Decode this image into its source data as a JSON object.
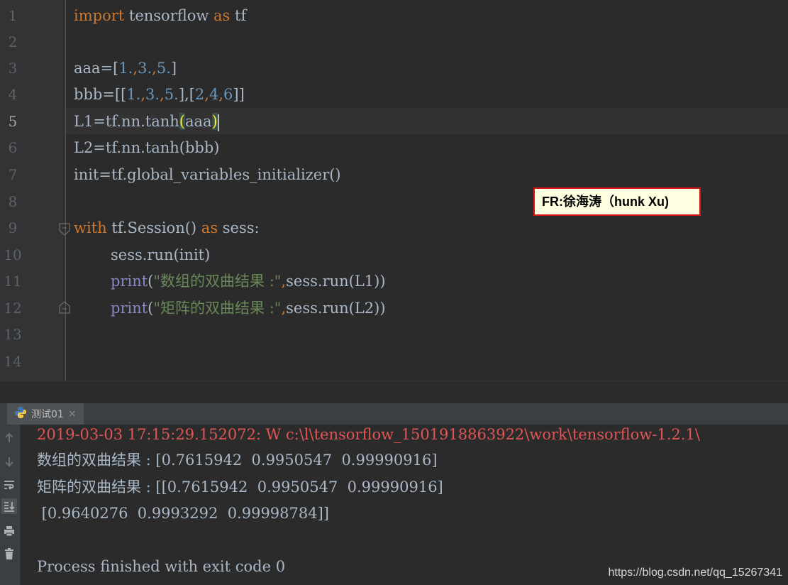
{
  "editor": {
    "line_numbers": [
      "1",
      "2",
      "3",
      "4",
      "5",
      "6",
      "7",
      "8",
      "9",
      "10",
      "11",
      "12",
      "13",
      "14"
    ],
    "line1": {
      "kw_import": "import",
      "module": " tensorflow ",
      "kw_as": "as",
      "alias": " tf"
    },
    "line3": {
      "lhs": "aaa=[",
      "n1": "1.",
      "c1": ",",
      "n2": "3.",
      "c2": ",",
      "n3": "5.",
      "end": "]"
    },
    "line4": {
      "lhs": "bbb=[[",
      "n1": "1.",
      "c1": ",",
      "n2": "3.",
      "c2": ",",
      "n3": "5.",
      "mid": "],[",
      "n4": "2",
      "c3": ",",
      "n5": "4",
      "c4": ",",
      "n6": "6",
      "end": "]]"
    },
    "line5": {
      "lhs": "L1=tf.nn.tanh",
      "open": "(",
      "arg": "aaa",
      "close": ")"
    },
    "line6": {
      "text": "L2=tf.nn.tanh(bbb)"
    },
    "line7": {
      "text": "init=tf.global_variables_initializer()"
    },
    "line9": {
      "kw_with": "with",
      "mid": " tf.Session() ",
      "kw_as": "as",
      "end": " sess:"
    },
    "line10": {
      "text": "sess.run(init)"
    },
    "line11": {
      "fn": "print",
      "open": "(",
      "str": "\"数组的双曲结果 :\"",
      "kw_comma": ",",
      "rest": "sess.run(L1))"
    },
    "line12": {
      "fn": "print",
      "open": "(",
      "str": "\"矩阵的双曲结果 :\"",
      "kw_comma": ",",
      "rest": "sess.run(L2))"
    }
  },
  "annotation": {
    "text": "FR:徐海涛（hunk Xu)"
  },
  "run_panel": {
    "tab_label": "测试01",
    "tab_close": "×",
    "toolbar_icons": [
      "arrow-up-icon",
      "arrow-down-icon",
      "soft-wrap-icon",
      "scroll-to-end-icon",
      "print-icon",
      "trash-icon"
    ],
    "output": [
      "2019-03-03 17:15:29.152072: W c:\\l\\tensorflow_1501918863922\\work\\tensorflow-1.2.1\\",
      "数组的双曲结果 : [0.7615942  0.9950547  0.99990916]",
      "矩阵的双曲结果 : [[0.7615942  0.9950547  0.99990916]",
      " [0.9640276  0.9993292  0.99998784]]",
      "",
      "Process finished with exit code 0"
    ]
  },
  "watermark": "https://blog.csdn.net/qq_15267341",
  "colors": {
    "keyword": "#cc7832",
    "number": "#6897bb",
    "string": "#6a8759",
    "builtin": "#8888c6",
    "error": "#e05555",
    "annotation_border": "#d8131a"
  }
}
